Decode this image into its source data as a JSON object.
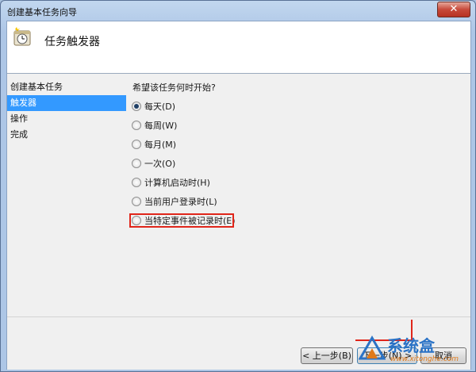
{
  "window": {
    "title": "创建基本任务向导",
    "close_glyph": "✕"
  },
  "header": {
    "title": "任务触发器",
    "icon": "clock-icon"
  },
  "nav": {
    "items": [
      {
        "label": "创建基本任务"
      },
      {
        "label": "触发器",
        "selected": true
      },
      {
        "label": "操作"
      },
      {
        "label": "完成"
      }
    ]
  },
  "main": {
    "question": "希望该任务何时开始?",
    "options": [
      {
        "label": "每天(D)",
        "checked": true
      },
      {
        "label": "每周(W)"
      },
      {
        "label": "每月(M)"
      },
      {
        "label": "一次(O)"
      },
      {
        "label": "计算机启动时(H)"
      },
      {
        "label": "当前用户登录时(L)",
        "highlighted": true
      },
      {
        "label": "当特定事件被记录时(E)"
      }
    ]
  },
  "footer": {
    "back_label": "< 上一步(B)",
    "next_label": "下一步(N) >",
    "cancel_label": "取消"
  },
  "watermark": {
    "text": "系统盒",
    "url": "www.xitonghe.com"
  },
  "colors": {
    "selection": "#3399ff",
    "highlight": "#e0251a",
    "accent": "#2b73c6"
  }
}
